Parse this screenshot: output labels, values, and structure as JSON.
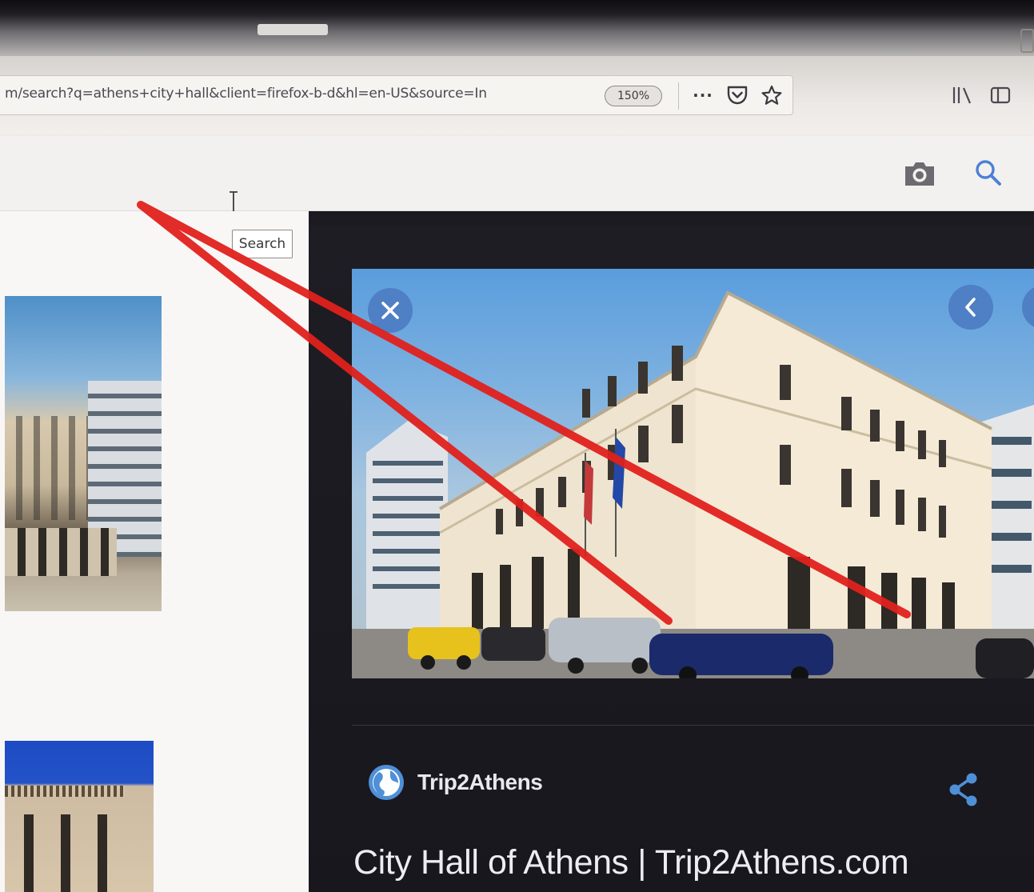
{
  "browser": {
    "url": "m/search?q=athens+city+hall&client=firefox-b-d&hl=en-US&source=In",
    "zoom": "150%",
    "page_actions": {
      "more": "···",
      "pocket": "pocket-icon",
      "bookmark": "star-icon"
    },
    "toolbar": {
      "library": "library-icon",
      "sidebar": "sidebar-icon"
    }
  },
  "search": {
    "query": "",
    "tooltip": "Search",
    "camera": "camera-icon",
    "submit": "search-icon"
  },
  "preview": {
    "close_icon": "close-icon",
    "prev_icon": "chevron-left-icon",
    "next_icon": "chevron-right-icon",
    "source": {
      "icon": "globe-icon",
      "name": "Trip2Athens"
    },
    "share_icon": "share-icon",
    "title": "City Hall of Athens | Trip2Athens.com"
  },
  "colors": {
    "accent_blue": "#4f7fc4",
    "panel_dark": "#1e1d24",
    "annotation_red": "#e0211c"
  }
}
